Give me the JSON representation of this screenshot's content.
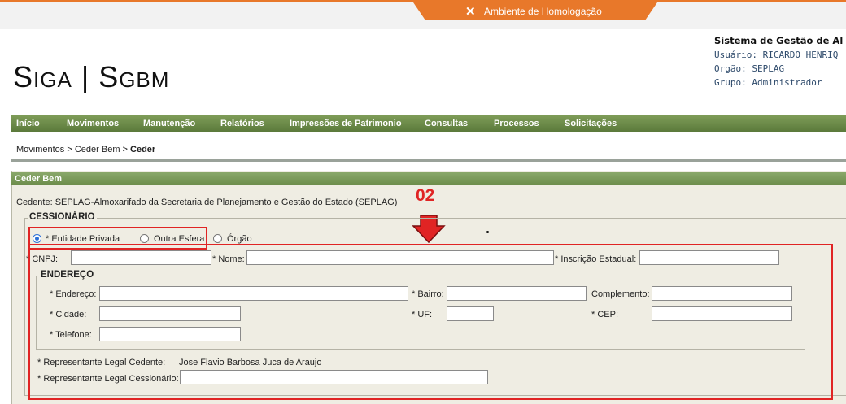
{
  "env": {
    "label": "Ambiente de Homologação",
    "icon": "tools-icon",
    "accent": "#e8782a"
  },
  "logo": {
    "s1": "S",
    "i1": "I",
    "g1": "GA",
    "sep": " | ",
    "s2": "S",
    "g2": "GBM"
  },
  "system": {
    "title": "Sistema de Gestão de Al",
    "user": "Usuário: RICARDO HENRIQ",
    "organ": "Orgão: SEPLAG",
    "group": "Grupo: Administrador"
  },
  "menu": [
    "Início",
    "Movimentos",
    "Manutenção",
    "Relatórios",
    "Impressões de Patrimonio",
    "Consultas",
    "Processos",
    "Solicitações"
  ],
  "breadcrumb": {
    "a": "Movimentos",
    "sep1": " > ",
    "b": "Ceder Bem",
    "sep2": " > ",
    "c": "Ceder"
  },
  "panel": {
    "title": "Ceder Bem"
  },
  "cedente": "Cedente: SEPLAG-Almoxarifado da Secretaria de Planejamento e Gestão do Estado (SEPLAG)",
  "annotation": "02",
  "cessionario": {
    "legend": "CESSIONÁRIO",
    "options": [
      "* Entidade Privada",
      "Outra Esfera",
      "Órgão"
    ],
    "selected": "* Entidade Privada",
    "cnpj_label": "* CNPJ:",
    "nome_label": "* Nome:",
    "ie_label": "* Inscrição Estadual:"
  },
  "endereco": {
    "legend": "ENDEREÇO",
    "endereco_label": "* Endereço:",
    "bairro_label": "* Bairro:",
    "complemento_label": "Complemento:",
    "cidade_label": "* Cidade:",
    "uf_label": "* UF:",
    "cep_label": "* CEP:",
    "telefone_label": "* Telefone:"
  },
  "representantes": {
    "cedente_label": "* Representante Legal Cedente:",
    "cedente_value": "Jose Flavio Barbosa Juca de Araujo",
    "cessionario_label": "* Representante Legal Cessionário:"
  }
}
